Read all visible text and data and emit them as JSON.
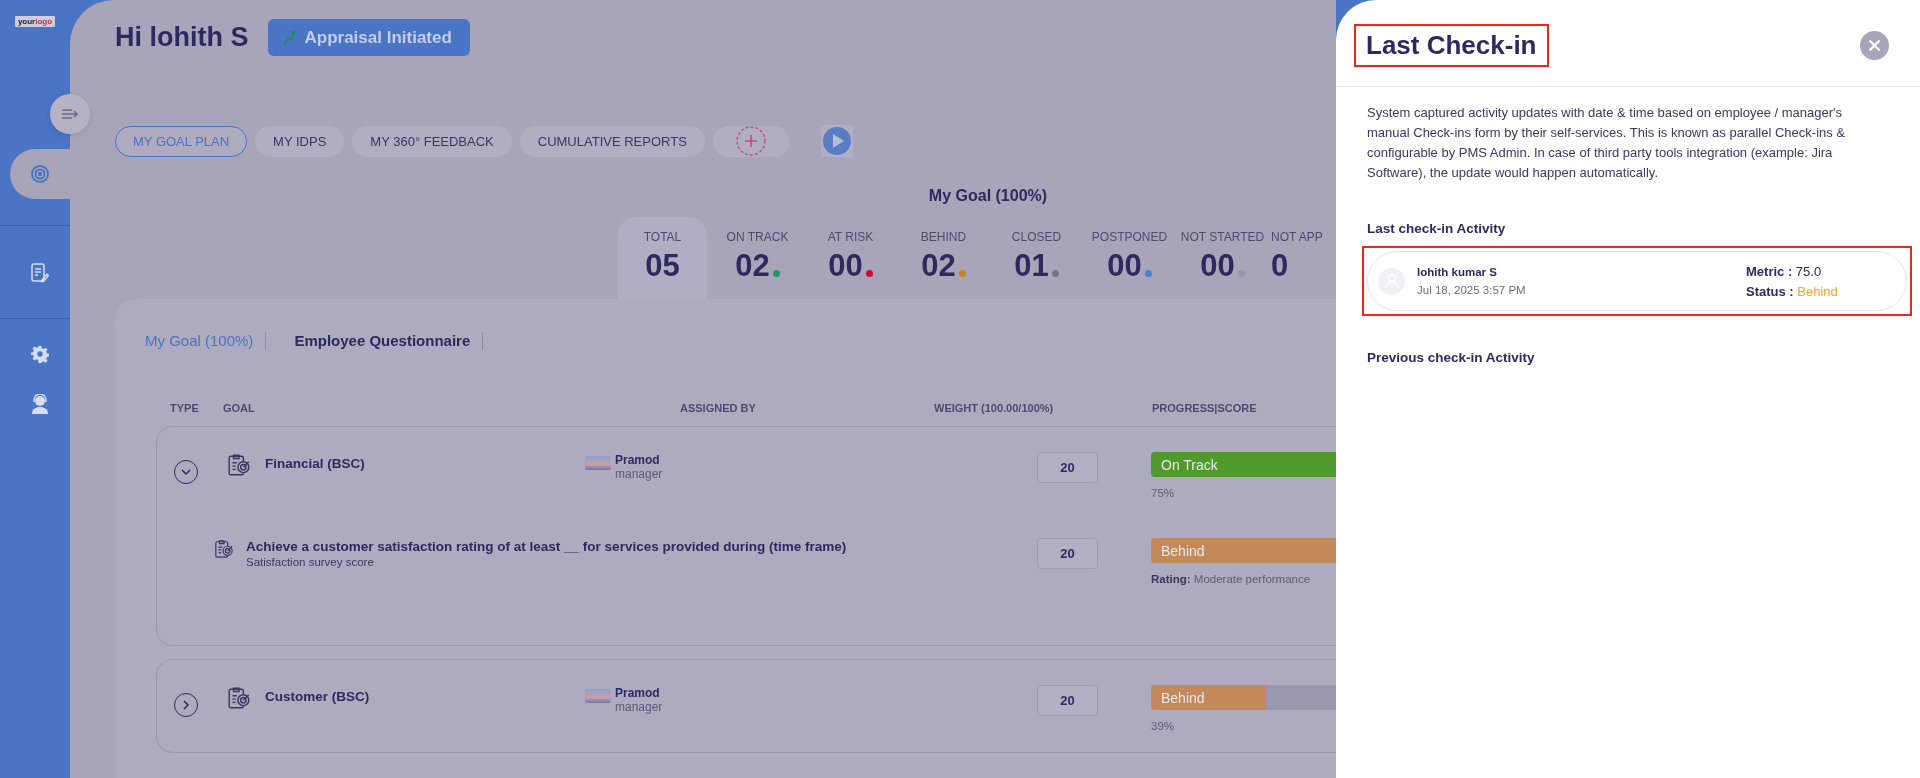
{
  "sidebar": {
    "logo": [
      "your",
      "logo"
    ],
    "items": [
      {
        "kind": "target",
        "selected": true
      },
      {
        "kind": "document",
        "selected": false
      },
      {
        "kind": "gear",
        "selected": false
      },
      {
        "kind": "support",
        "selected": false
      }
    ]
  },
  "header": {
    "greeting": "Hi lohith S",
    "status_button": "Appraisal Initiated"
  },
  "nav_tabs": [
    {
      "label": "MY GOAL PLAN",
      "selected": true
    },
    {
      "label": "MY IDPS",
      "selected": false
    },
    {
      "label": "MY 360° FEEDBACK",
      "selected": false
    },
    {
      "label": "CUMULATIVE REPORTS",
      "selected": false
    }
  ],
  "summary": {
    "title": "My Goal (100%)",
    "stats": [
      {
        "label": "TOTAL",
        "value": "05",
        "selected": true
      },
      {
        "label": "ON TRACK",
        "value": "02",
        "color": "#1f9a6b",
        "selected": false
      },
      {
        "label": "AT RISK",
        "value": "00",
        "color": "#c8102e",
        "selected": false
      },
      {
        "label": "BEHIND",
        "value": "02",
        "color": "#c8831e",
        "selected": false
      },
      {
        "label": "CLOSED",
        "value": "01",
        "color": "#77748a",
        "selected": false
      },
      {
        "label": "POSTPONED",
        "value": "00",
        "color": "#4a7fd4",
        "selected": false
      },
      {
        "label": "NOT STARTED",
        "value": "00",
        "color": "#9a97ab",
        "selected": false
      },
      {
        "label": "NOT APP",
        "value": "0",
        "selected": false
      }
    ]
  },
  "sub_tabs": [
    {
      "label": "My Goal (100%)",
      "selected": true
    },
    {
      "label": "Employee Questionnaire",
      "selected": false
    }
  ],
  "table": {
    "columns": [
      "TYPE",
      "GOAL",
      "ASSIGNED BY",
      "WEIGHT (100.00/100%)",
      "PROGRESS|SCORE"
    ],
    "groups": [
      {
        "expanded": true,
        "title": "Financial (BSC)",
        "assigned_by": {
          "name": "Pramod",
          "role": "manager"
        },
        "weight": "20",
        "progress": {
          "status": "On Track",
          "color": "#4f9a2a",
          "level": 0.75,
          "caption": "75%"
        },
        "children": [
          {
            "title": "Achieve a customer satisfaction rating of at least __ for services provided during (time frame)",
            "subtitle": "Satisfaction survey score",
            "weight": "20",
            "progress": {
              "status": "Behind",
              "color": "#c4895a",
              "level": 0.75,
              "caption": "**Rating:** Moderate performance"
            }
          }
        ]
      },
      {
        "expanded": false,
        "title": "Customer (BSC)",
        "assigned_by": {
          "name": "Pramod",
          "role": "manager"
        },
        "weight": "20",
        "progress": {
          "status": "Behind",
          "color": "#c4895a",
          "level": 0.39,
          "caption": "39%"
        }
      }
    ]
  },
  "panel": {
    "title": "Last Check-in",
    "description": "System captured activity updates with date & time based on employee / manager's manual Check-ins form by their self-services. This is known as parallel Check-ins & configurable by PMS Admin. In case of third party tools integration (example: Jira Software), the update would happen automatically.",
    "last_heading": "Last check-in Activity",
    "entries": [
      {
        "name": "lohith kumar S",
        "date": "Jul 18, 2025 3:57 PM",
        "metric": "**Metric :** 75.0",
        "status_label": "Status :",
        "status": "Behind"
      }
    ],
    "previous_heading": "Previous check-in Activity"
  }
}
